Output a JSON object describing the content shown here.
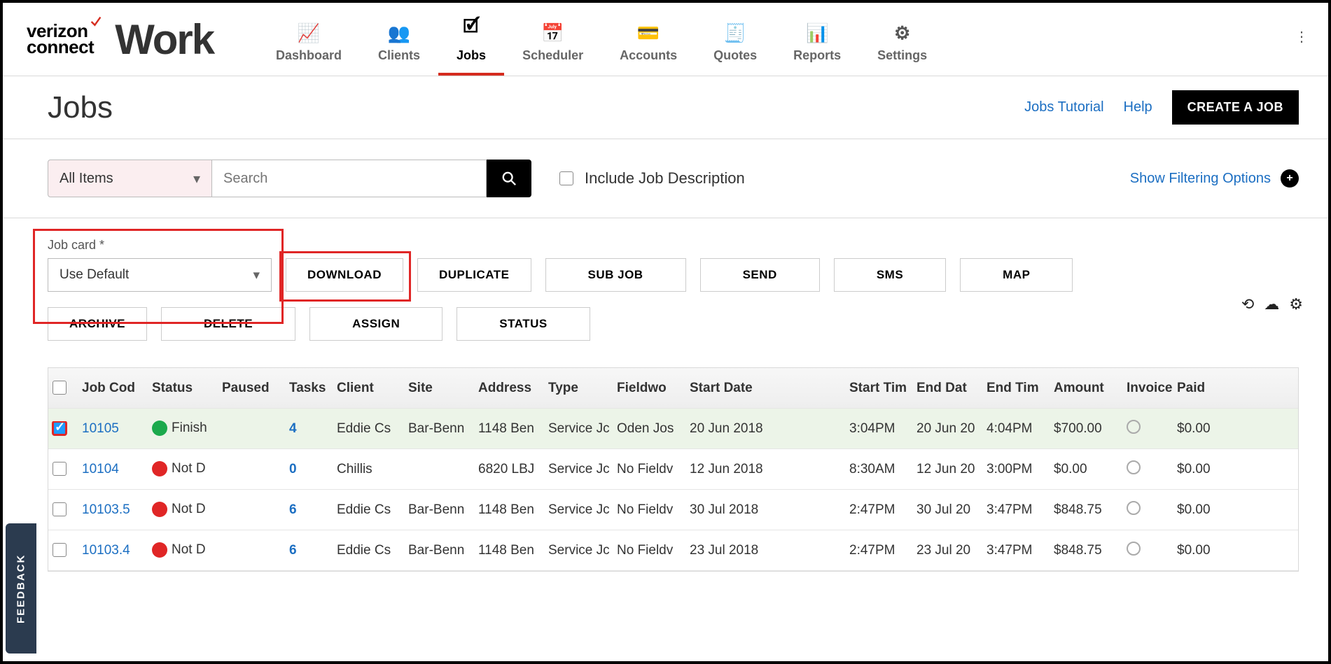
{
  "brand": {
    "line1": "verizon",
    "line2": "connect",
    "work": "Work"
  },
  "nav": {
    "items": [
      {
        "label": "Dashboard"
      },
      {
        "label": "Clients"
      },
      {
        "label": "Jobs"
      },
      {
        "label": "Scheduler"
      },
      {
        "label": "Accounts"
      },
      {
        "label": "Quotes"
      },
      {
        "label": "Reports"
      },
      {
        "label": "Settings"
      }
    ],
    "active_index": 2
  },
  "page": {
    "title": "Jobs",
    "links": {
      "tutorial": "Jobs Tutorial",
      "help": "Help"
    },
    "create_btn": "CREATE A JOB"
  },
  "filter": {
    "dropdown": "All Items",
    "search_placeholder": "Search",
    "include_label": "Include Job Description",
    "show_filters": "Show Filtering Options"
  },
  "toolbar": {
    "jobcard_label": "Job card *",
    "jobcard_value": "Use Default",
    "buttons": {
      "download": "DOWNLOAD",
      "duplicate": "DUPLICATE",
      "subjob": "SUB JOB",
      "send": "SEND",
      "sms": "SMS",
      "map": "MAP",
      "archive": "ARCHIVE",
      "delete": "DELETE",
      "assign": "ASSIGN",
      "status": "STATUS"
    }
  },
  "table": {
    "columns": [
      "",
      "Job Cod",
      "Status",
      "Paused",
      "Tasks",
      "Client",
      "Site",
      "Address",
      "Type",
      "Fieldwo",
      "Start Date",
      "Start Tim",
      "End Dat",
      "End Tim",
      "Amount",
      "Invoiced",
      "Paid"
    ],
    "rows": [
      {
        "checked": true,
        "job_code": "10105",
        "status_badge": "green",
        "status": "Finish",
        "paused": "",
        "tasks": "4",
        "client": "Eddie Cs",
        "site": "Bar-Benn",
        "address": "1148 Ben",
        "type": "Service Jc",
        "fieldworker": "Oden Jos",
        "start_date": "20 Jun 2018",
        "start_time": "3:04PM",
        "end_date": "20 Jun 20",
        "end_time": "4:04PM",
        "amount": "$700.00",
        "invoiced": false,
        "paid": "$0.00"
      },
      {
        "checked": false,
        "job_code": "10104",
        "status_badge": "red",
        "status": "Not D",
        "paused": "",
        "tasks": "0",
        "client": "Chillis",
        "site": "",
        "address": "6820 LBJ",
        "type": "Service Jc",
        "fieldworker": "No Fieldv",
        "start_date": "12 Jun 2018",
        "start_time": "8:30AM",
        "end_date": "12 Jun 20",
        "end_time": "3:00PM",
        "amount": "$0.00",
        "invoiced": false,
        "paid": "$0.00"
      },
      {
        "checked": false,
        "job_code": "10103.5",
        "status_badge": "red",
        "status": "Not D",
        "paused": "",
        "tasks": "6",
        "client": "Eddie Cs",
        "site": "Bar-Benn",
        "address": "1148 Ben",
        "type": "Service Jc",
        "fieldworker": "No Fieldv",
        "start_date": "30 Jul 2018",
        "start_time": "2:47PM",
        "end_date": "30 Jul 20",
        "end_time": "3:47PM",
        "amount": "$848.75",
        "invoiced": false,
        "paid": "$0.00"
      },
      {
        "checked": false,
        "job_code": "10103.4",
        "status_badge": "red",
        "status": "Not D",
        "paused": "",
        "tasks": "6",
        "client": "Eddie Cs",
        "site": "Bar-Benn",
        "address": "1148 Ben",
        "type": "Service Jc",
        "fieldworker": "No Fieldv",
        "start_date": "23 Jul 2018",
        "start_time": "2:47PM",
        "end_date": "23 Jul 20",
        "end_time": "3:47PM",
        "amount": "$848.75",
        "invoiced": false,
        "paid": "$0.00"
      }
    ]
  },
  "feedback": "FEEDBACK"
}
